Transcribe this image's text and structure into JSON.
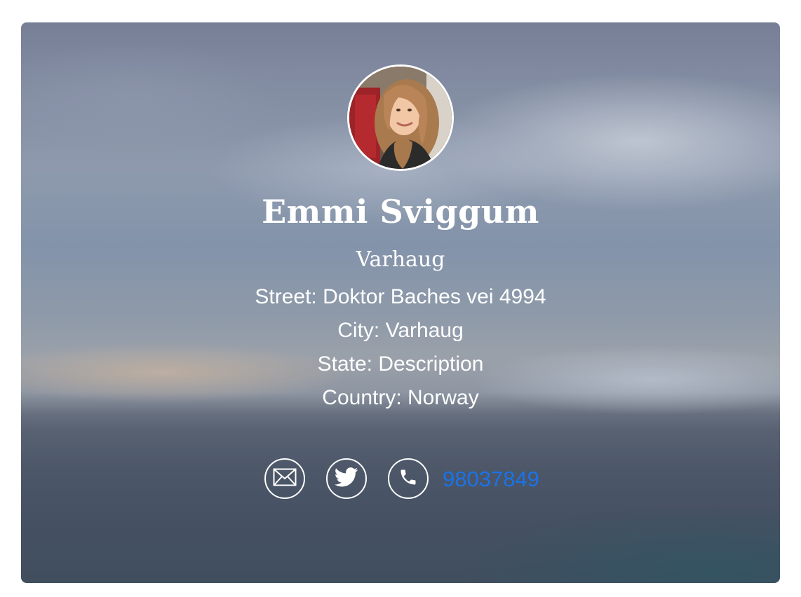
{
  "profile": {
    "name": "Emmi Sviggum",
    "subtitle": "Varhaug",
    "street": "Street: Doktor Baches vei 4994",
    "city": "City: Varhaug",
    "state": "State: Description",
    "country": "Country: Norway",
    "phone": "98037849"
  },
  "icons": {
    "email": "mail-icon",
    "twitter": "twitter-icon",
    "phone": "phone-icon"
  },
  "colors": {
    "text": "#ffffff",
    "link": "#1a73e8"
  }
}
